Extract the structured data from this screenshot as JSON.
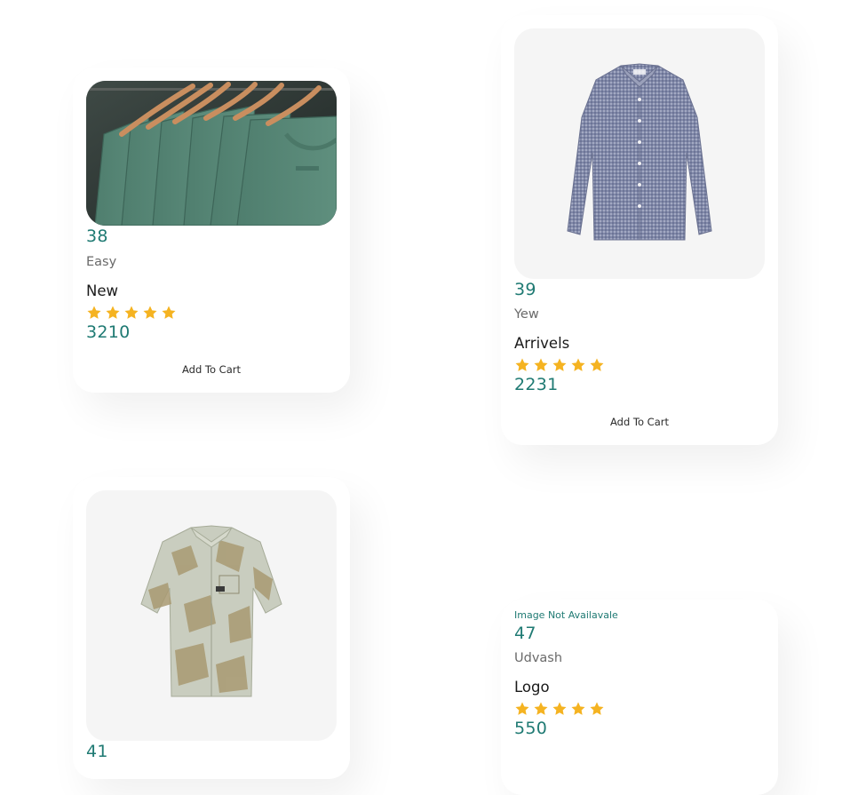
{
  "colors": {
    "accent": "#1f7a73",
    "star": "#f5b321",
    "image_bg": "#f5f5f5"
  },
  "rating_icon": "star-icon",
  "products": [
    {
      "id": "38",
      "brand": "Easy",
      "title": "New",
      "rating": 5,
      "price": "3210",
      "cart_label": "Add To Cart",
      "image": "green-tshirts-on-wooden-hangers"
    },
    {
      "id": "39",
      "brand": "Yew",
      "title": "Arrivels",
      "rating": 5,
      "price": "2231",
      "cart_label": "Add To Cart",
      "image": "grey-checked-long-sleeve-shirt"
    },
    {
      "id": "41",
      "image": "sage-printed-short-sleeve-shirt"
    },
    {
      "id": "47",
      "image_missing_text": "Image Not Availavale",
      "brand": "Udvash",
      "title": "Logo",
      "rating": 5,
      "price": "550"
    }
  ]
}
